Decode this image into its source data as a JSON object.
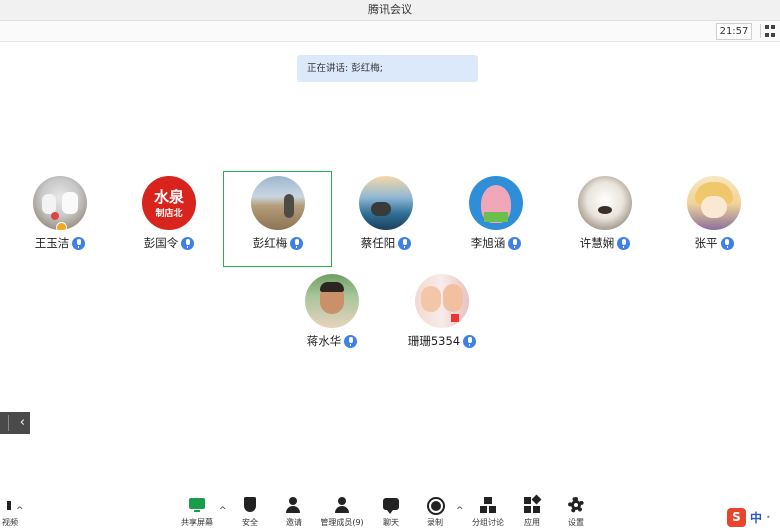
{
  "window": {
    "title": "腾讯会议"
  },
  "topbar": {
    "time": "21:57"
  },
  "banner": {
    "speaking_text": "正在讲话: 彭红梅;"
  },
  "participants": [
    {
      "name": "王玉洁"
    },
    {
      "name": "彭国令",
      "avatar_text_1": "水泉",
      "avatar_text_2": "制店北"
    },
    {
      "name": "彭红梅"
    },
    {
      "name": "蔡任阳"
    },
    {
      "name": "李旭涵"
    },
    {
      "name": "许慧娴"
    },
    {
      "name": "张平"
    },
    {
      "name": "蒋水华"
    },
    {
      "name": "珊珊5354"
    }
  ],
  "bottombar": {
    "video_label": "视频",
    "items": [
      {
        "label": "共享屏幕"
      },
      {
        "label": "安全"
      },
      {
        "label": "邀请"
      },
      {
        "label": "管理成员(9)"
      },
      {
        "label": "聊天"
      },
      {
        "label": "录制"
      },
      {
        "label": "分组讨论"
      },
      {
        "label": "应用"
      },
      {
        "label": "设置"
      }
    ]
  },
  "ime": {
    "logo": "S",
    "mode": "中"
  },
  "colors": {
    "active_border": "#27b24a",
    "mic_blue": "#3f7fe8",
    "banner_bg": "#dbe9fb"
  }
}
